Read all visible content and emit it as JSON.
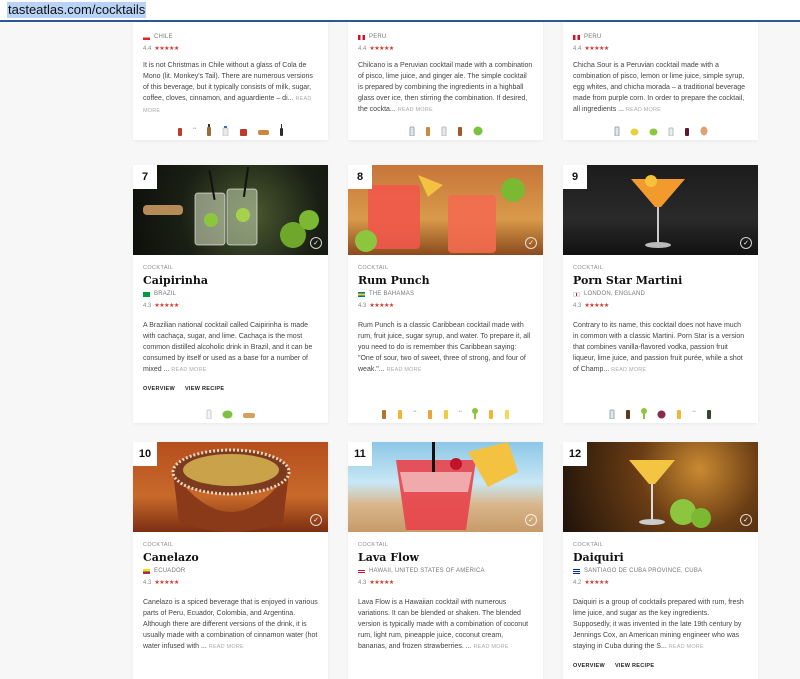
{
  "browser": {
    "url": "tasteatlas.com/cocktails"
  },
  "colors": {
    "accent": "#d9342b",
    "url_highlight": "#b8d3f5",
    "url_border": "#2b5797"
  },
  "top_cards": [
    {
      "origin": "CHILE",
      "rating": "4.4",
      "desc": "It is not Christmas in Chile without a glass of Cola de Mono (lit. Monkey's Tail). There are numerous versions of this beverage, but it typically consists of milk, sugar, coffee, cloves, cinnamon, and aguardiente – di...",
      "more": "READ MORE"
    },
    {
      "origin": "PERU",
      "rating": "4.4",
      "desc": "Chilcano is a Peruvian cocktail made with a combination of pisco, lime juice, and ginger ale. The simple cocktail is prepared by combining the ingredients in a highball glass over ice, then stirring the combination. If desired, the cockta...",
      "more": "READ MORE"
    },
    {
      "origin": "PERU",
      "rating": "4.4",
      "desc": "Chicha Sour is a Peruvian cocktail made with a combination of pisco, lemon or lime juice, simple syrup, egg whites, and chicha morada – a traditional beverage made from purple corn. In order to prepare the cocktail, all ingredients ...",
      "more": "READ MORE"
    }
  ],
  "cards": [
    {
      "rank": "7",
      "category": "COCKTAIL",
      "name": "Caipirinha",
      "origin": "BRAZIL",
      "rating": "4.3",
      "desc": "A Brazilian national cocktail called Caipirinha is made with cachaça, sugar, and lime. Cachaça is the most common distilled alcoholic drink in Brazil, and it can be consumed by itself or used as a base for a number of mixed ...",
      "more": "READ MORE",
      "overview": "OVERVIEW",
      "recipe": "VIEW RECIPE"
    },
    {
      "rank": "8",
      "category": "COCKTAIL",
      "name": "Rum Punch",
      "origin": "THE BAHAMAS",
      "rating": "4.3",
      "desc": "Rum Punch is a classic Caribbean cocktail made with rum, fruit juice, sugar syrup, and water. To prepare it, all you need to do is remember this Caribbean saying: \"One of sour, two of sweet, three of strong, and four of weak.\"...",
      "more": "READ MORE"
    },
    {
      "rank": "9",
      "category": "COCKTAIL",
      "name": "Porn Star Martini",
      "origin": "LONDON, ENGLAND",
      "rating": "4.3",
      "desc": "Contrary to its name, this cocktail does not have much in common with a classic Martini. Porn Star is a version that combines vanilla-flavored vodka, passion fruit liqueur, lime juice, and passion fruit purée, while a shot of Champ...",
      "more": "READ MORE"
    },
    {
      "rank": "10",
      "category": "COCKTAIL",
      "name": "Canelazo",
      "origin": "ECUADOR",
      "rating": "4.3",
      "desc": "Canelazo is a spiced beverage that is enjoyed in various parts of Peru, Ecuador, Colombia, and Argentina. Although there are different versions of the drink, it is usually made with a combination of cinnamon water (hot water infused with ...",
      "more": "READ MORE"
    },
    {
      "rank": "11",
      "category": "COCKTAIL",
      "name": "Lava Flow",
      "origin": "HAWAII, UNITED STATES OF AMERICA",
      "rating": "4.3",
      "desc": "Lava Flow is a Hawaiian cocktail with numerous variations. It can be blended or shaken. The blended version is typically made with a combination of coconut rum, light rum, pineapple juice, coconut cream, bananas, and frozen strawberries. ...",
      "more": "READ MORE"
    },
    {
      "rank": "12",
      "category": "COCKTAIL",
      "name": "Daiquiri",
      "origin": "SANTIAGO DE CUBA PROVINCE, CUBA",
      "rating": "4.2",
      "desc": "Daiquiri is a group of cocktails prepared with rum, fresh lime juice, and sugar as the key ingredients. Supposedly, it was invented in the late 19th century by Jennings Cox, an American mining engineer who was staying in Cuba during the S...",
      "more": "READ MORE",
      "overview": "OVERVIEW",
      "recipe": "VIEW RECIPE"
    }
  ],
  "icons": [
    "check-icon",
    "star-icon",
    "flag-icon",
    "ingredient-icon"
  ]
}
